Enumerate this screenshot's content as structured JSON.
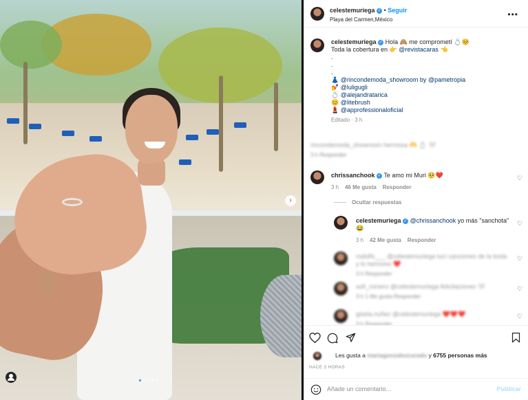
{
  "post": {
    "username": "celestemuriega",
    "follow_label": "Seguir",
    "location": "Playa del Carmen,México",
    "more": "•••"
  },
  "caption": {
    "username": "celestemuriega",
    "line1": "Hola 🙈 me comprometí 💍🥺",
    "line2_prefix": "Toda la cobertura en 👉",
    "line2_mention": "@revistacaras",
    "line2_suffix": "👈",
    "dot1": ".",
    "dot2": ".",
    "dot3": ".",
    "credits": [
      {
        "emoji": "👗",
        "text": "@rincondemoda_showroom by ",
        "mention2": "@pametropia"
      },
      {
        "emoji": "💅",
        "text": "@luligugli",
        "mention2": ""
      },
      {
        "emoji": "💍",
        "text": "@alejandratarica",
        "mention2": ""
      },
      {
        "emoji": "😊",
        "text": "@litebrush",
        "mention2": ""
      },
      {
        "emoji": "💄",
        "text": "@approfessionaloficial",
        "mention2": ""
      }
    ],
    "edited": "Editado · 3 h"
  },
  "blurred_comment": {
    "text": "rincondemoda_showroom hermosa 🫶 💍 🤍",
    "sub": "3 h   Responder"
  },
  "comment1": {
    "username": "chrissanchook",
    "text": "Te amo mi Muri 🥺❤️",
    "time": "3 h",
    "likes": "46 Me gusta",
    "reply": "Responder"
  },
  "hide_replies": "Ocultar respuestas",
  "reply1": {
    "username": "celestemuriega",
    "mention": "@chrissanchook",
    "text": " yo más \"sanchota\"",
    "emoji": "😂",
    "time": "3 h",
    "likes": "42 Me gusta",
    "reply": "Responder"
  },
  "blurred_replies": [
    {
      "text": "rodolfo___ @celestemuriega lucí canciones de la boda y lo hermoso ❤️",
      "sub": "3 h   Responder"
    },
    {
      "text": "sofi_romero @celestemuriega felicitaciones 🤍",
      "sub": "3 h   1 Me gusta   Responder"
    },
    {
      "text": "gisela.nuñez @celestemuriega ❤️❤️❤️",
      "sub": "3 h   Responder"
    }
  ],
  "likes": {
    "prefix": "Les gusta a ",
    "blurred_user": "mariagonzalezcurado",
    "suffix": " y ",
    "count": "6755 personas más"
  },
  "date": "HACE 3 HORAS",
  "comment_input": {
    "placeholder": "Añade un comentario..."
  },
  "publish_label": "Publicar",
  "carousel": {
    "total_dots": 5,
    "active_index": 0
  }
}
